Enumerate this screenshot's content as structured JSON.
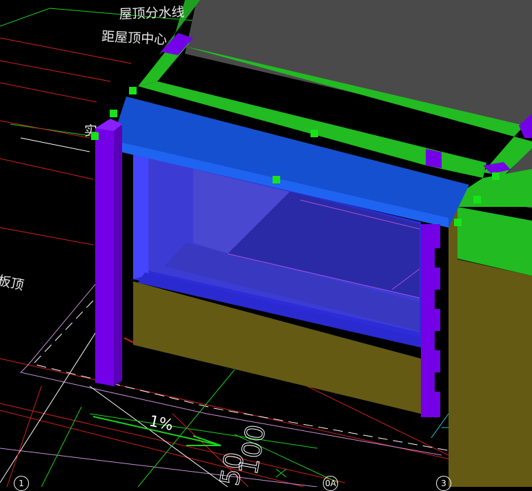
{
  "annotations": {
    "roof_divide": "屋顶分水线",
    "roof_center": "距屋顶中心",
    "frag_left": "实",
    "slab_top": "板顶",
    "slope": "1%",
    "dim_a": "100",
    "dim_b": "50"
  },
  "grid_axes": {
    "axis_1": "1",
    "axis_0a": "0A",
    "axis_3": "3"
  },
  "colors": {
    "background": "#000000",
    "roof_slab": "#4a4a4a",
    "parapet_green": "#22bb22",
    "beam_blue": "#1550d0",
    "column_purple": "#7300e6",
    "wall_olive": "#645a14",
    "grip_green": "#18e318"
  }
}
